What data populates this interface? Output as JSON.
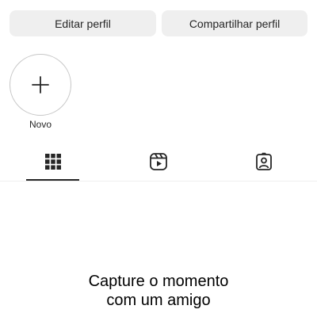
{
  "profile_actions": {
    "edit_label": "Editar perfil",
    "share_label": "Compartilhar perfil"
  },
  "highlights": {
    "new_label": "Novo",
    "new_icon": "plus-icon"
  },
  "tabs": [
    {
      "name": "posts",
      "icon": "grid-icon",
      "active": true
    },
    {
      "name": "reels",
      "icon": "reels-icon",
      "active": false
    },
    {
      "name": "tagged",
      "icon": "tagged-user-icon",
      "active": false
    }
  ],
  "empty_state": {
    "title": "Capture o momento\ncom um amigo"
  },
  "colors": {
    "button_bg": "#efefef",
    "text": "#262626",
    "divider": "#efefef"
  }
}
